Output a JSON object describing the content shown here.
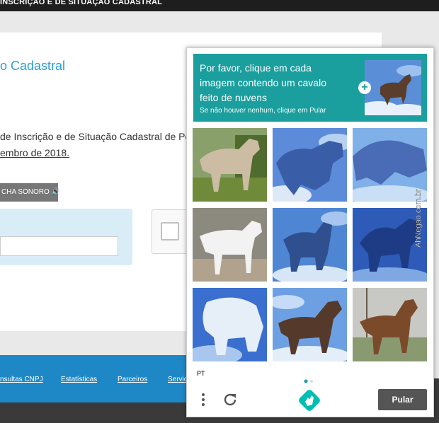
{
  "page": {
    "topbar_title": "INSCRIÇÃO E DE SITUAÇÃO CADASTRAL",
    "title": "o Cadastral",
    "lead_line1": "de Inscrição e de Situação Cadastral de Pe",
    "lead_line2": "embro de 2018.",
    "audio_button": "CHA SONORO 🔊",
    "footer_links": [
      "nsultas CNPJ",
      "Estatísticas",
      "Parceiros",
      "Servic"
    ]
  },
  "captcha": {
    "instruction_lines": [
      "Por favor, clique em cada",
      "imagem contendo um cavalo",
      "feito de nuvens"
    ],
    "sub_instruction": "Se não houver nenhum, clique em Pular",
    "language": "PT",
    "skip_label": "Pular",
    "watermark": "AhNegao.com.br",
    "tiles": [
      {
        "name": "horse-dun-field",
        "sky": "#8aa06a",
        "body": "#cbbca3",
        "ground": "#6f8b3a"
      },
      {
        "name": "cloud-horse-blue",
        "sky": "#5b8bd9",
        "body": "#3a5da8",
        "ground": "#dce8f6"
      },
      {
        "name": "cloud-horse-grazing",
        "sky": "#7fb0e8",
        "body": "#4a6bb5",
        "ground": "#c9dff5"
      },
      {
        "name": "horse-white-paddock",
        "sky": "#8c8a7f",
        "body": "#f2f2f2",
        "ground": "#b0a28c"
      },
      {
        "name": "cloud-horse-rider",
        "sky": "#4f86d4",
        "body": "#2f4f8f",
        "ground": "#d6e6f7"
      },
      {
        "name": "cloud-horse-dark",
        "sky": "#2d5bb7",
        "body": "#1e3c86",
        "ground": "#7fa8e3"
      },
      {
        "name": "cloud-elephant",
        "sky": "#3a6fcf",
        "body": "#e6eef8",
        "ground": "#a9c6ee"
      },
      {
        "name": "cloud-horse-standing",
        "sky": "#6da0e3",
        "body": "#553a2b",
        "ground": "#e4eef9"
      },
      {
        "name": "horse-bay-snow",
        "sky": "#c8c8c4",
        "body": "#7a4a2b",
        "ground": "#8a9a70"
      }
    ]
  }
}
